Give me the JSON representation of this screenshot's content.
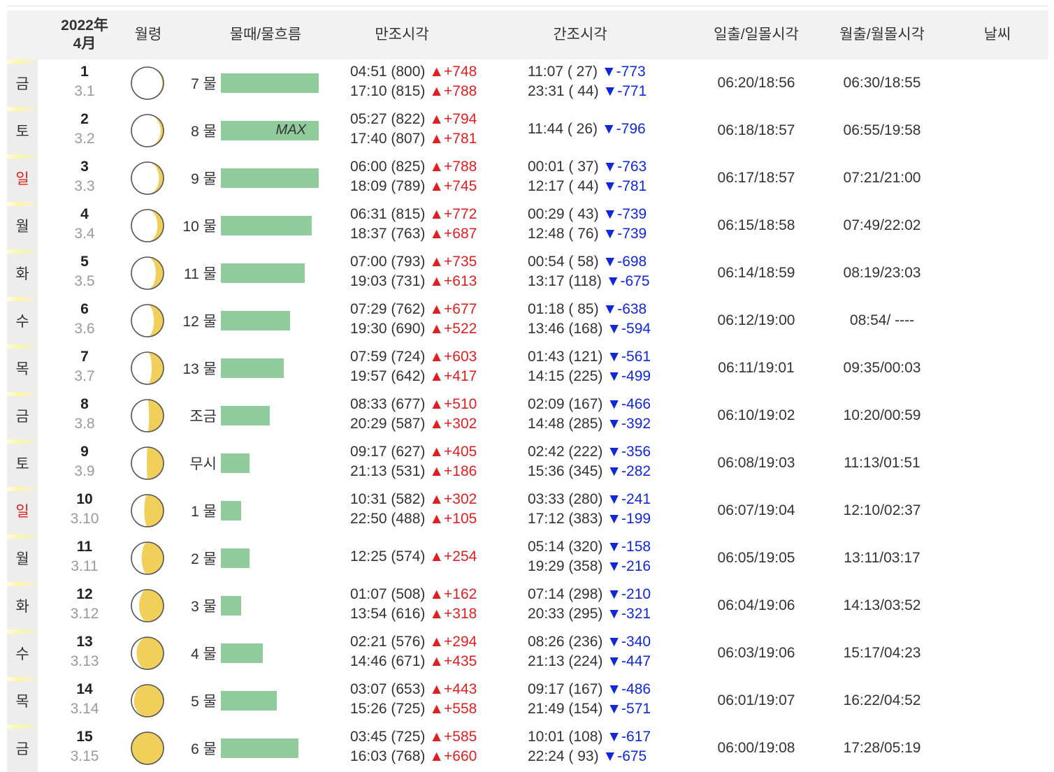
{
  "header": {
    "year": "2022年",
    "month": "4月",
    "moon_age": "월령",
    "tide_flow": "물때/물흐름",
    "high_tide": "만조시각",
    "low_tide": "간조시각",
    "sunrise_sunset": "일출/일몰시각",
    "moonrise_moonset": "월출/월몰시각",
    "weather": "날씨"
  },
  "colors": {
    "rise": "#e02020",
    "fall": "#1028d8",
    "bar": "#8fcb9b",
    "sunday": "#e02020",
    "moon_fill": "#f0cf5a"
  },
  "rows": [
    {
      "day": "금",
      "sunday": false,
      "date": "1",
      "lunar": "3.1",
      "phase": 0.04,
      "tide": "7 물",
      "flow": 1.0,
      "max": "",
      "high": [
        {
          "t": "04:51 (800)",
          "d": "+748"
        },
        {
          "t": "17:10 (815)",
          "d": "+788"
        }
      ],
      "low": [
        {
          "t": "11:07 ( 27)",
          "d": "-773"
        },
        {
          "t": "23:31 ( 44)",
          "d": "-771"
        }
      ],
      "sun": "06:20/18:56",
      "moon": "06:30/18:55"
    },
    {
      "day": "토",
      "sunday": false,
      "date": "2",
      "lunar": "3.2",
      "phase": 0.09,
      "tide": "8 물",
      "flow": 1.0,
      "max": "MAX",
      "high": [
        {
          "t": "05:27 (822)",
          "d": "+794"
        },
        {
          "t": "17:40 (807)",
          "d": "+781"
        }
      ],
      "low": [
        {
          "t": "11:44 ( 26)",
          "d": "-796"
        }
      ],
      "sun": "06:18/18:57",
      "moon": "06:55/19:58"
    },
    {
      "day": "일",
      "sunday": true,
      "date": "3",
      "lunar": "3.3",
      "phase": 0.14,
      "tide": "9 물",
      "flow": 1.0,
      "max": "",
      "high": [
        {
          "t": "06:00 (825)",
          "d": "+788"
        },
        {
          "t": "18:09 (789)",
          "d": "+745"
        }
      ],
      "low": [
        {
          "t": "00:01 ( 37)",
          "d": "-763"
        },
        {
          "t": "12:17 ( 44)",
          "d": "-781"
        }
      ],
      "sun": "06:17/18:57",
      "moon": "07:21/21:00"
    },
    {
      "day": "월",
      "sunday": false,
      "date": "4",
      "lunar": "3.4",
      "phase": 0.19,
      "tide": "10 물",
      "flow": 0.93,
      "max": "",
      "high": [
        {
          "t": "06:31 (815)",
          "d": "+772"
        },
        {
          "t": "18:37 (763)",
          "d": "+687"
        }
      ],
      "low": [
        {
          "t": "00:29 ( 43)",
          "d": "-739"
        },
        {
          "t": "12:48 ( 76)",
          "d": "-739"
        }
      ],
      "sun": "06:15/18:58",
      "moon": "07:49/22:02"
    },
    {
      "day": "화",
      "sunday": false,
      "date": "5",
      "lunar": "3.5",
      "phase": 0.24,
      "tide": "11 물",
      "flow": 0.86,
      "max": "",
      "high": [
        {
          "t": "07:00 (793)",
          "d": "+735"
        },
        {
          "t": "19:03 (731)",
          "d": "+613"
        }
      ],
      "low": [
        {
          "t": "00:54 ( 58)",
          "d": "-698"
        },
        {
          "t": "13:17 (118)",
          "d": "-675"
        }
      ],
      "sun": "06:14/18:59",
      "moon": "08:19/23:03"
    },
    {
      "day": "수",
      "sunday": false,
      "date": "6",
      "lunar": "3.6",
      "phase": 0.3,
      "tide": "12 물",
      "flow": 0.71,
      "max": "",
      "high": [
        {
          "t": "07:29 (762)",
          "d": "+677"
        },
        {
          "t": "19:30 (690)",
          "d": "+522"
        }
      ],
      "low": [
        {
          "t": "01:18 ( 85)",
          "d": "-638"
        },
        {
          "t": "13:46 (168)",
          "d": "-594"
        }
      ],
      "sun": "06:12/19:00",
      "moon": "08:54/ ----"
    },
    {
      "day": "목",
      "sunday": false,
      "date": "7",
      "lunar": "3.7",
      "phase": 0.37,
      "tide": "13 물",
      "flow": 0.64,
      "max": "",
      "high": [
        {
          "t": "07:59 (724)",
          "d": "+603"
        },
        {
          "t": "19:57 (642)",
          "d": "+417"
        }
      ],
      "low": [
        {
          "t": "01:43 (121)",
          "d": "-561"
        },
        {
          "t": "14:15 (225)",
          "d": "-499"
        }
      ],
      "sun": "06:11/19:01",
      "moon": "09:35/00:03"
    },
    {
      "day": "금",
      "sunday": false,
      "date": "8",
      "lunar": "3.8",
      "phase": 0.45,
      "tide": "조금",
      "flow": 0.5,
      "max": "",
      "high": [
        {
          "t": "08:33 (677)",
          "d": "+510"
        },
        {
          "t": "20:29 (587)",
          "d": "+302"
        }
      ],
      "low": [
        {
          "t": "02:09 (167)",
          "d": "-466"
        },
        {
          "t": "14:48 (285)",
          "d": "-392"
        }
      ],
      "sun": "06:10/19:02",
      "moon": "10:20/00:59"
    },
    {
      "day": "토",
      "sunday": false,
      "date": "9",
      "lunar": "3.9",
      "phase": 0.52,
      "tide": "무시",
      "flow": 0.29,
      "max": "",
      "high": [
        {
          "t": "09:17 (627)",
          "d": "+405"
        },
        {
          "t": "21:13 (531)",
          "d": "+186"
        }
      ],
      "low": [
        {
          "t": "02:42 (222)",
          "d": "-356"
        },
        {
          "t": "15:36 (345)",
          "d": "-282"
        }
      ],
      "sun": "06:08/19:03",
      "moon": "11:13/01:51"
    },
    {
      "day": "일",
      "sunday": true,
      "date": "10",
      "lunar": "3.10",
      "phase": 0.6,
      "tide": "1 물",
      "flow": 0.21,
      "max": "",
      "high": [
        {
          "t": "10:31 (582)",
          "d": "+302"
        },
        {
          "t": "22:50 (488)",
          "d": "+105"
        }
      ],
      "low": [
        {
          "t": "03:33 (280)",
          "d": "-241"
        },
        {
          "t": "17:12 (383)",
          "d": "-199"
        }
      ],
      "sun": "06:07/19:04",
      "moon": "12:10/02:37"
    },
    {
      "day": "월",
      "sunday": false,
      "date": "11",
      "lunar": "3.11",
      "phase": 0.68,
      "tide": "2 물",
      "flow": 0.29,
      "max": "",
      "high": [
        {
          "t": "12:25 (574)",
          "d": "+254"
        }
      ],
      "low": [
        {
          "t": "05:14 (320)",
          "d": "-158"
        },
        {
          "t": "19:29 (358)",
          "d": "-216"
        }
      ],
      "sun": "06:05/19:05",
      "moon": "13:11/03:17"
    },
    {
      "day": "화",
      "sunday": false,
      "date": "12",
      "lunar": "3.12",
      "phase": 0.76,
      "tide": "3 물",
      "flow": 0.21,
      "max": "",
      "high": [
        {
          "t": "01:07 (508)",
          "d": "+162"
        },
        {
          "t": "13:54 (616)",
          "d": "+318"
        }
      ],
      "low": [
        {
          "t": "07:14 (298)",
          "d": "-210"
        },
        {
          "t": "20:33 (295)",
          "d": "-321"
        }
      ],
      "sun": "06:04/19:06",
      "moon": "14:13/03:52"
    },
    {
      "day": "수",
      "sunday": false,
      "date": "13",
      "lunar": "3.13",
      "phase": 0.84,
      "tide": "4 물",
      "flow": 0.43,
      "max": "",
      "high": [
        {
          "t": "02:21 (576)",
          "d": "+294"
        },
        {
          "t": "14:46 (671)",
          "d": "+435"
        }
      ],
      "low": [
        {
          "t": "08:26 (236)",
          "d": "-340"
        },
        {
          "t": "21:13 (224)",
          "d": "-447"
        }
      ],
      "sun": "06:03/19:06",
      "moon": "15:17/04:23"
    },
    {
      "day": "목",
      "sunday": false,
      "date": "14",
      "lunar": "3.14",
      "phase": 0.92,
      "tide": "5 물",
      "flow": 0.57,
      "max": "",
      "high": [
        {
          "t": "03:07 (653)",
          "d": "+443"
        },
        {
          "t": "15:26 (725)",
          "d": "+558"
        }
      ],
      "low": [
        {
          "t": "09:17 (167)",
          "d": "-486"
        },
        {
          "t": "21:49 (154)",
          "d": "-571"
        }
      ],
      "sun": "06:01/19:07",
      "moon": "16:22/04:52"
    },
    {
      "day": "금",
      "sunday": false,
      "date": "15",
      "lunar": "3.15",
      "phase": 1.0,
      "tide": "6 물",
      "flow": 0.79,
      "max": "",
      "high": [
        {
          "t": "03:45 (725)",
          "d": "+585"
        },
        {
          "t": "16:03 (768)",
          "d": "+660"
        }
      ],
      "low": [
        {
          "t": "10:01 (108)",
          "d": "-617"
        },
        {
          "t": "22:24 ( 93)",
          "d": "-675"
        }
      ],
      "sun": "06:00/19:08",
      "moon": "17:28/05:19"
    }
  ]
}
